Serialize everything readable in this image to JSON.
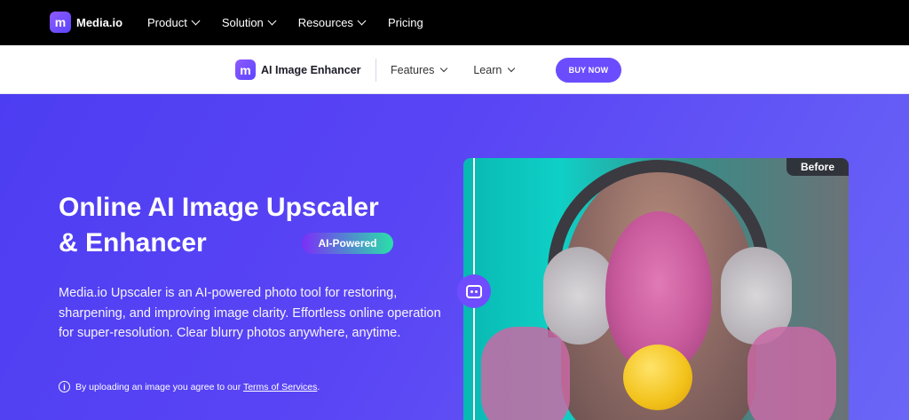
{
  "topbar": {
    "brand": "Media.io",
    "brand_mark": "m",
    "nav": [
      {
        "label": "Product",
        "has_dropdown": true
      },
      {
        "label": "Solution",
        "has_dropdown": true
      },
      {
        "label": "Resources",
        "has_dropdown": true
      },
      {
        "label": "Pricing",
        "has_dropdown": false
      }
    ]
  },
  "subbar": {
    "product_name": "AI Image Enhancer",
    "product_mark": "m",
    "nav": [
      {
        "label": "Features",
        "has_dropdown": true
      },
      {
        "label": "Learn",
        "has_dropdown": true
      }
    ],
    "buy_label": "BUY NOW"
  },
  "hero": {
    "title_line1": "Online AI Image Upscaler",
    "title_line2": "& Enhancer",
    "badge": "AI-Powered",
    "description": "Media.io Upscaler is an AI-powered photo tool for restoring, sharpening, and improving image clarity. Effortless online operation for super-resolution. Clear blurry photos anywhere, anytime.",
    "terms_prefix": "By uploading an image you agree to our ",
    "terms_link": "Terms of Services",
    "terms_suffix": "."
  },
  "compare": {
    "before_label": "Before"
  },
  "colors": {
    "accent": "#6b4dff",
    "hero_bg": "#4d3df2",
    "badge_from": "#7b2ff7",
    "badge_to": "#2ae0a8"
  }
}
